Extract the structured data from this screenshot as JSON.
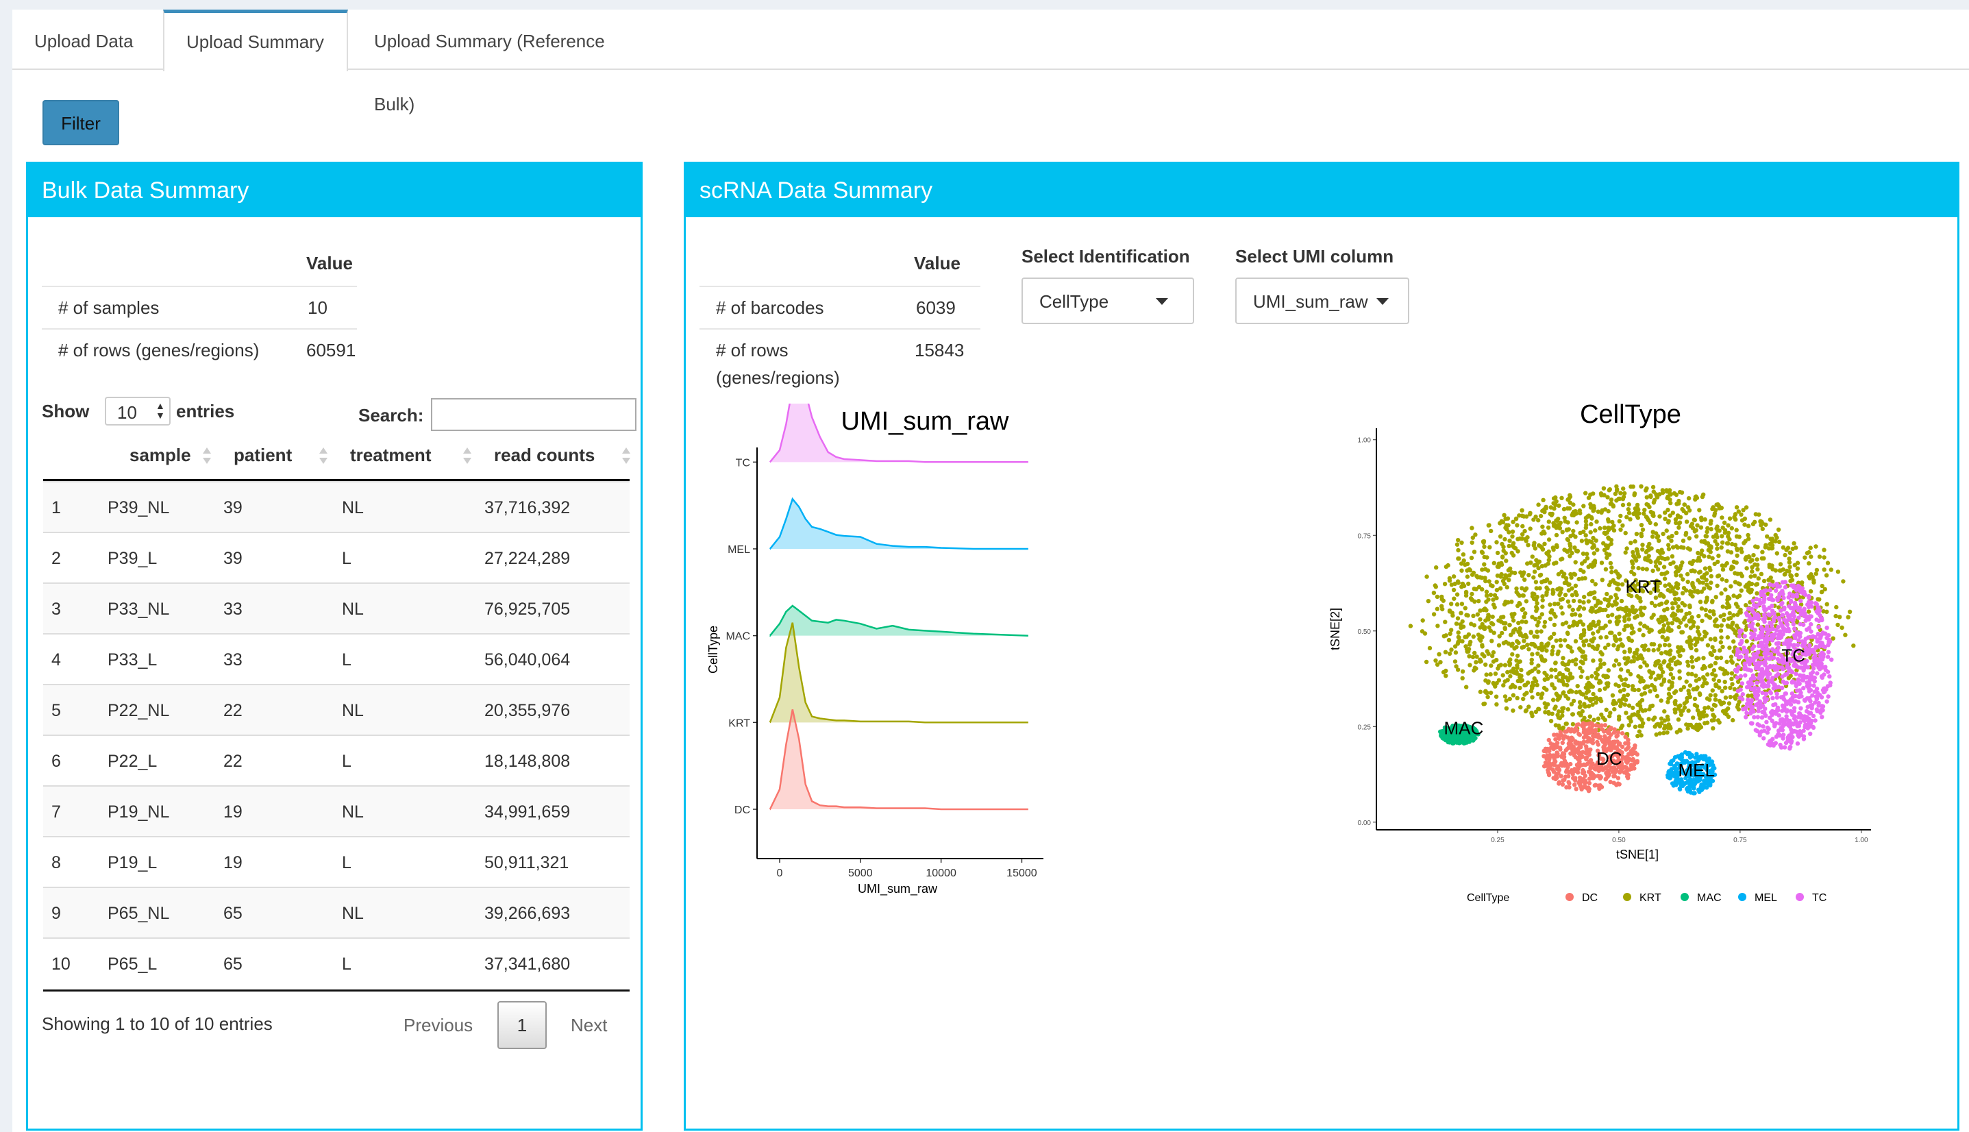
{
  "tabs": [
    {
      "label": "Upload Data",
      "active": false
    },
    {
      "label": "Upload Summary",
      "active": true
    },
    {
      "label": "Upload Summary (Reference Bulk)",
      "active": false
    }
  ],
  "filter_button": "Filter",
  "bulk": {
    "title": "Bulk Data Summary",
    "value_header": "Value",
    "rows": [
      {
        "label": "# of samples",
        "value": "10"
      },
      {
        "label": "# of rows (genes/regions)",
        "value": "60591"
      }
    ],
    "show_label": "Show",
    "show_value": "10",
    "entries_label": "entries",
    "search_label": "Search:",
    "search_value": "",
    "columns": [
      "",
      "sample",
      "patient",
      "treatment",
      "read counts"
    ],
    "table": [
      [
        "1",
        "P39_NL",
        "39",
        "NL",
        "37,716,392"
      ],
      [
        "2",
        "P39_L",
        "39",
        "L",
        "27,224,289"
      ],
      [
        "3",
        "P33_NL",
        "33",
        "NL",
        "76,925,705"
      ],
      [
        "4",
        "P33_L",
        "33",
        "L",
        "56,040,064"
      ],
      [
        "5",
        "P22_NL",
        "22",
        "NL",
        "20,355,976"
      ],
      [
        "6",
        "P22_L",
        "22",
        "L",
        "18,148,808"
      ],
      [
        "7",
        "P19_NL",
        "19",
        "NL",
        "34,991,659"
      ],
      [
        "8",
        "P19_L",
        "19",
        "L",
        "50,911,321"
      ],
      [
        "9",
        "P65_NL",
        "65",
        "NL",
        "39,266,693"
      ],
      [
        "10",
        "P65_L",
        "65",
        "L",
        "37,341,680"
      ]
    ],
    "info": "Showing 1 to 10 of 10 entries",
    "prev": "Previous",
    "page": "1",
    "next": "Next"
  },
  "scrna": {
    "title": "scRNA Data Summary",
    "value_header": "Value",
    "rows": [
      {
        "label": "# of barcodes",
        "value": "6039"
      },
      {
        "label_line1": "# of rows",
        "label_line2": "(genes/regions)",
        "value": "15843"
      }
    ],
    "select_id_label": "Select Identification",
    "select_id_value": "CellType",
    "select_umi_label": "Select UMI column",
    "select_umi_value": "UMI_sum_raw"
  },
  "colors": {
    "DC": "#F8766D",
    "KRT": "#A3A500",
    "MAC": "#00BF7D",
    "MEL": "#00B0F6",
    "TC": "#E76BF3",
    "box_header": "#00c0ef",
    "button": "#3c8dbc"
  },
  "chart_data": [
    {
      "type": "area",
      "subtype": "ridgeline",
      "title": "UMI_sum_raw",
      "xlabel": "UMI_sum_raw",
      "ylabel": "CellType",
      "xlim": [
        -1400,
        16000
      ],
      "x_ticks": [
        "0",
        "5000",
        "10000",
        "15000"
      ],
      "categories": [
        "DC",
        "KRT",
        "MAC",
        "MEL",
        "TC"
      ],
      "x": [
        -600,
        0,
        400,
        800,
        1200,
        1600,
        2000,
        2500,
        3000,
        3500,
        4000,
        5000,
        6000,
        7000,
        8000,
        9000,
        10000,
        12000,
        15400
      ],
      "series": [
        {
          "name": "DC",
          "values": [
            0,
            0.2,
            0.65,
            1.0,
            0.7,
            0.25,
            0.08,
            0.04,
            0.03,
            0.03,
            0.02,
            0.02,
            0.01,
            0.01,
            0.01,
            0.01,
            0,
            0,
            0
          ]
        },
        {
          "name": "KRT",
          "values": [
            0,
            0.25,
            0.75,
            1.0,
            0.55,
            0.2,
            0.06,
            0.04,
            0.03,
            0.02,
            0.02,
            0.01,
            0.01,
            0.01,
            0.01,
            0,
            0,
            0,
            0
          ]
        },
        {
          "name": "MAC",
          "values": [
            0,
            0.12,
            0.24,
            0.3,
            0.25,
            0.2,
            0.15,
            0.14,
            0.13,
            0.16,
            0.15,
            0.12,
            0.07,
            0.1,
            0.06,
            0.05,
            0.04,
            0.02,
            0
          ]
        },
        {
          "name": "MEL",
          "values": [
            0,
            0.12,
            0.3,
            0.5,
            0.42,
            0.3,
            0.22,
            0.2,
            0.17,
            0.14,
            0.13,
            0.12,
            0.05,
            0.03,
            0.02,
            0.02,
            0.01,
            0,
            0
          ]
        },
        {
          "name": "TC",
          "values": [
            0,
            0.12,
            0.38,
            0.75,
            0.9,
            0.7,
            0.45,
            0.25,
            0.1,
            0.05,
            0.03,
            0.02,
            0.01,
            0.01,
            0.01,
            0,
            0,
            0,
            0
          ]
        }
      ],
      "ridge_scale": 1.0
    },
    {
      "type": "scatter",
      "title": "CellType",
      "xlabel": "tSNE[1]",
      "ylabel": "tSNE[2]",
      "xlim": [
        0.0,
        1.02
      ],
      "ylim": [
        -0.02,
        1.03
      ],
      "x_ticks": [
        "0.25",
        "0.50",
        "0.75",
        "1.00"
      ],
      "y_ticks": [
        "0.00",
        "0.25",
        "0.50",
        "0.75",
        "1.00"
      ],
      "legend_title": "CellType",
      "legend_position": "bottom",
      "clusters": [
        {
          "name": "KRT",
          "cx": 0.53,
          "cy": 0.55,
          "rx": 0.4,
          "ry": 0.33,
          "n": 2600,
          "label": "KRT",
          "lx": 0.55,
          "ly": 0.6
        },
        {
          "name": "TC",
          "cx": 0.84,
          "cy": 0.41,
          "rx": 0.1,
          "ry": 0.22,
          "n": 900,
          "label": "TC",
          "lx": 0.86,
          "ly": 0.42
        },
        {
          "name": "DC",
          "cx": 0.44,
          "cy": 0.17,
          "rx": 0.1,
          "ry": 0.09,
          "n": 500,
          "label": "DC",
          "lx": 0.48,
          "ly": 0.15
        },
        {
          "name": "MEL",
          "cx": 0.65,
          "cy": 0.13,
          "rx": 0.05,
          "ry": 0.055,
          "n": 220,
          "label": "MEL",
          "lx": 0.66,
          "ly": 0.12
        },
        {
          "name": "MAC",
          "cx": 0.17,
          "cy": 0.23,
          "rx": 0.04,
          "ry": 0.025,
          "n": 220,
          "label": "MAC",
          "lx": 0.18,
          "ly": 0.23
        }
      ]
    }
  ]
}
